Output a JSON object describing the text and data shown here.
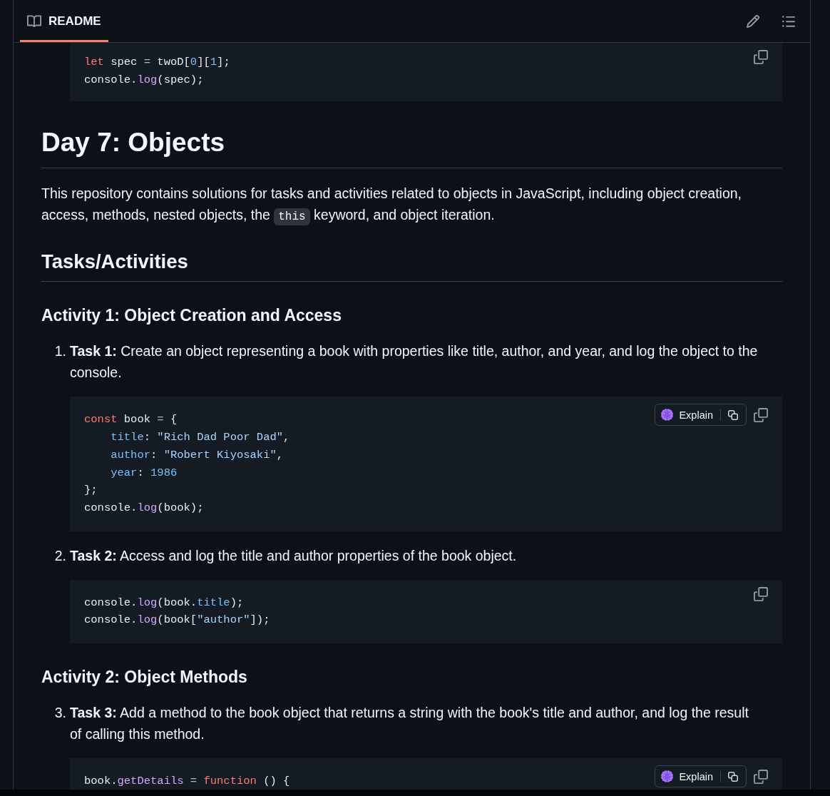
{
  "readme_header": {
    "tab": {
      "label": "README",
      "selected": true
    }
  },
  "content": [
    {
      "kind": "code",
      "lines": [
        {
          "indented": false,
          "tokens": [
            {
              "kind": "keyword",
              "text": "let"
            },
            {
              "kind": "plain",
              "text": " spec "
            },
            {
              "kind": "operator",
              "text": "="
            },
            {
              "kind": "plain",
              "text": " twoD["
            },
            {
              "kind": "number",
              "text": "0"
            },
            {
              "kind": "plain",
              "text": "]["
            },
            {
              "kind": "number",
              "text": "1"
            },
            {
              "kind": "plain",
              "text": "];"
            }
          ]
        },
        {
          "indented": false,
          "tokens": [
            {
              "kind": "plain",
              "text": "console."
            },
            {
              "kind": "function",
              "text": "log"
            },
            {
              "kind": "plain",
              "text": "(spec);"
            }
          ]
        }
      ]
    },
    {
      "kind": "h1",
      "text": "Day 7: Objects"
    },
    {
      "kind": "paragraph",
      "parts": [
        {
          "kind": "text",
          "text": "This repository contains solutions for tasks and activities related to objects in JavaScript, including object creation, access, methods, nested objects, the "
        },
        {
          "kind": "code",
          "text": "this"
        },
        {
          "kind": "text",
          "text": " keyword, and object iteration."
        }
      ]
    },
    {
      "kind": "h2",
      "text": "Tasks/Activities"
    },
    {
      "kind": "h3",
      "text": "Activity 1: Object Creation and Access"
    },
    {
      "kind": "task",
      "number": "1.",
      "text": "**Task 1:** Create an object representing a book with properties like title, author, and year, and log the object to the console.",
      "code": {
        "explain_label": "Explain",
        "lines": [
          {
            "indented": false,
            "tokens": [
              {
                "kind": "keyword",
                "text": "const"
              },
              {
                "kind": "plain",
                "text": " book "
              },
              {
                "kind": "operator",
                "text": "="
              },
              {
                "kind": "plain",
                "text": " {"
              }
            ]
          },
          {
            "indented": true,
            "tokens": [
              {
                "kind": "property",
                "text": "title"
              },
              {
                "kind": "plain",
                "text": ": "
              },
              {
                "kind": "string",
                "text": "\"Rich Dad Poor Dad\""
              },
              {
                "kind": "plain",
                "text": ","
              }
            ]
          },
          {
            "indented": true,
            "tokens": [
              {
                "kind": "property",
                "text": "author"
              },
              {
                "kind": "plain",
                "text": ": "
              },
              {
                "kind": "string",
                "text": "\"Robert Kiyosaki\""
              },
              {
                "kind": "plain",
                "text": ","
              }
            ]
          },
          {
            "indented": true,
            "tokens": [
              {
                "kind": "property",
                "text": "year"
              },
              {
                "kind": "plain",
                "text": ": "
              },
              {
                "kind": "number",
                "text": "1986"
              }
            ]
          },
          {
            "indented": false,
            "tokens": [
              {
                "kind": "plain",
                "text": "};"
              }
            ]
          },
          {
            "indented": false,
            "tokens": [
              {
                "kind": "plain",
                "text": "console."
              },
              {
                "kind": "function",
                "text": "log"
              },
              {
                "kind": "plain",
                "text": "(book);"
              }
            ]
          }
        ]
      }
    },
    {
      "kind": "task",
      "number": "2.",
      "text": "**Task 2:** Access and log the title and author properties of the book object.",
      "code": {
        "lines": [
          {
            "indented": false,
            "tokens": [
              {
                "kind": "plain",
                "text": "console."
              },
              {
                "kind": "function",
                "text": "log"
              },
              {
                "kind": "plain",
                "text": "(book."
              },
              {
                "kind": "property",
                "text": "title"
              },
              {
                "kind": "plain",
                "text": ");"
              }
            ]
          },
          {
            "indented": false,
            "tokens": [
              {
                "kind": "plain",
                "text": "console."
              },
              {
                "kind": "function",
                "text": "log"
              },
              {
                "kind": "plain",
                "text": "(book["
              },
              {
                "kind": "string",
                "text": "\"author\""
              },
              {
                "kind": "plain",
                "text": "]);"
              }
            ]
          }
        ]
      }
    },
    {
      "kind": "h3",
      "text": "Activity 2: Object Methods"
    },
    {
      "kind": "task",
      "number": "3.",
      "text": "**Task 3:** Add a method to the book object that returns a string with the book's title and author, and log the result of calling this method.",
      "code": {
        "explain_label": "Explain",
        "lines": [
          {
            "indented": false,
            "tokens": [
              {
                "kind": "plain",
                "text": "book."
              },
              {
                "kind": "function",
                "text": "getDetails"
              },
              {
                "kind": "operator",
                "text": " = "
              },
              {
                "kind": "keyword",
                "text": "function"
              },
              {
                "kind": "plain",
                "text": " () {"
              }
            ]
          }
        ]
      }
    }
  ]
}
